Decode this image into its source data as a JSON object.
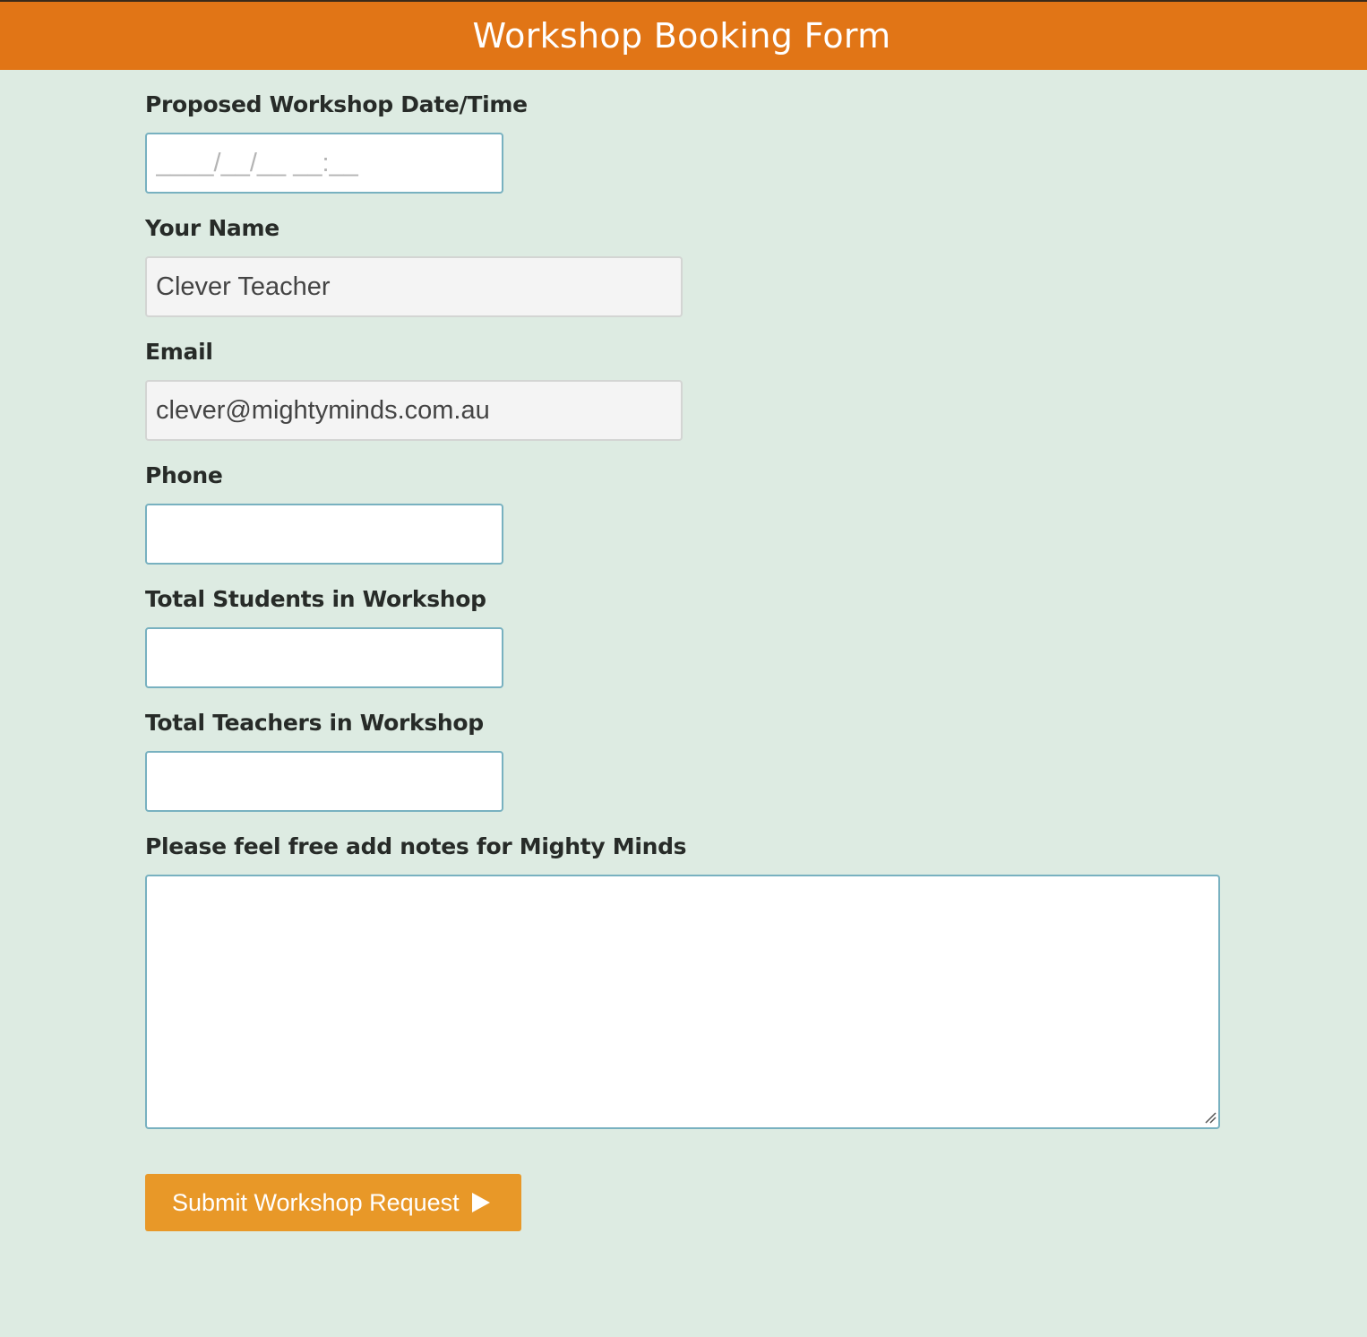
{
  "header": {
    "title": "Workshop Booking Form"
  },
  "form": {
    "date_label": "Proposed Workshop Date/Time",
    "date_placeholder": "____/__/__ __:__",
    "name_label": "Your Name",
    "name_value": "Clever Teacher",
    "email_label": "Email",
    "email_value": "clever@mightyminds.com.au",
    "phone_label": "Phone",
    "phone_value": "",
    "students_label": "Total Students in Workshop",
    "students_value": "",
    "teachers_label": "Total Teachers in Workshop",
    "teachers_value": "",
    "notes_label": "Please feel free add notes for Mighty Minds",
    "notes_value": "",
    "submit_label": "Submit Workshop Request",
    "submit_icon": "play-arrow-icon"
  },
  "colors": {
    "header_bg": "#e17516",
    "page_bg": "#ddebe2",
    "button_bg": "#e89828",
    "input_border": "#78b1c0"
  }
}
